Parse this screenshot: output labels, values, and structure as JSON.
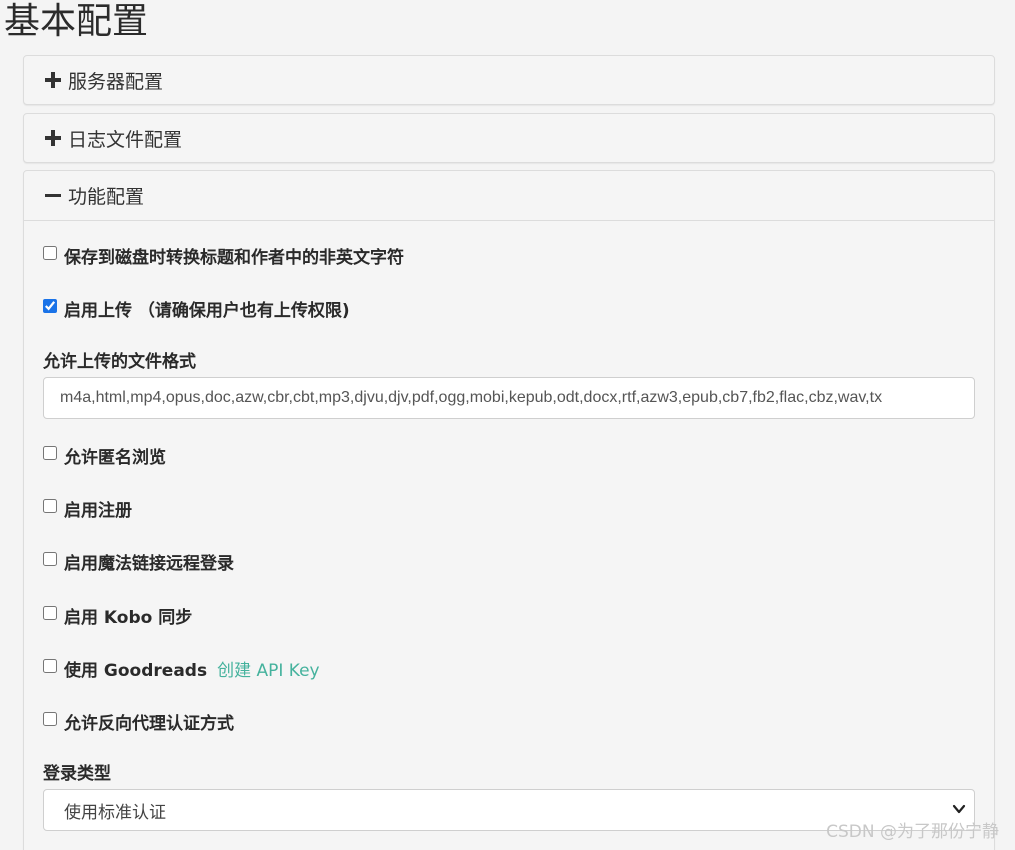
{
  "page_title": "基本配置",
  "panels": {
    "server": {
      "label": "服务器配置",
      "icon": "plus-icon"
    },
    "log": {
      "label": "日志文件配置",
      "icon": "plus-icon"
    },
    "feature": {
      "label": "功能配置",
      "icon": "minus-icon"
    }
  },
  "features": {
    "convert_non_english": {
      "label": "保存到磁盘时转换标题和作者中的非英文字符",
      "checked": false
    },
    "enable_upload": {
      "label": "启用上传 （请确保用户也有上传权限)",
      "checked": true
    },
    "upload_formats": {
      "label": "允许上传的文件格式",
      "value": "m4a,html,mp4,opus,doc,azw,cbr,cbt,mp3,djvu,djv,pdf,ogg,mobi,kepub,odt,docx,rtf,azw3,epub,cb7,fb2,flac,cbz,wav,tx"
    },
    "anonymous_browse": {
      "label": "允许匿名浏览",
      "checked": false
    },
    "enable_register": {
      "label": "启用注册",
      "checked": false
    },
    "magic_link": {
      "label": "启用魔法链接远程登录",
      "checked": false
    },
    "kobo_sync": {
      "label": "启用 Kobo 同步",
      "checked": false
    },
    "goodreads": {
      "label": "使用 Goodreads",
      "checked": false,
      "link": "创建 API Key"
    },
    "reverse_proxy": {
      "label": "允许反向代理认证方式",
      "checked": false
    },
    "login_type": {
      "label": "登录类型",
      "selected": "使用标准认证"
    }
  },
  "watermark": "CSDN @为了那份宁静",
  "colors": {
    "link": "#45b29d",
    "checkbox_accent": "#1a73e8",
    "background": "#f4f4f4"
  }
}
